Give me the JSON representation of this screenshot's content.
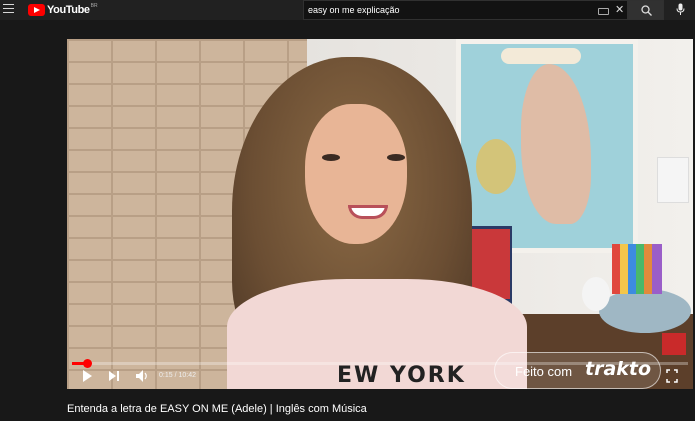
{
  "header": {
    "logo_text": "YouTube",
    "logo_country": "BR",
    "search_value": "easy on me explicação",
    "icons": [
      "menu-icon",
      "keyboard-icon",
      "clear-icon",
      "search-icon",
      "mic-icon"
    ]
  },
  "player": {
    "time": "0:15 / 10:42",
    "progress_fraction": 0.024,
    "watermark_label": "Feito com",
    "watermark_brand": "trakto",
    "shirt_text": "EW YORK",
    "colors": {
      "progress": "#ff0000",
      "background": "#181818"
    }
  },
  "video": {
    "title": "Entenda a letra de EASY ON ME (Adele) | Inglês com Música"
  }
}
